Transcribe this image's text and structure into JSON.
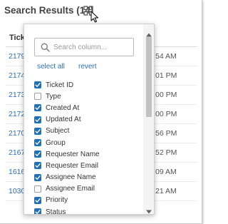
{
  "header": {
    "title": "Search Results (14)",
    "grid_icon": "grid-icon",
    "cursor_icon": "mouse-pointer-icon"
  },
  "table": {
    "column_header_visible": "Ticke",
    "rows": [
      {
        "id": "2179",
        "time": "54 AM"
      },
      {
        "id": "2174",
        "time": "01 PM"
      },
      {
        "id": "2173",
        "time": "00 PM"
      },
      {
        "id": "2172",
        "time": "00 PM"
      },
      {
        "id": "2170",
        "time": "56 PM"
      },
      {
        "id": "2167",
        "time": "52 PM"
      },
      {
        "id": "1616",
        "time": "09 AM"
      },
      {
        "id": "1030",
        "time": "21 AM"
      }
    ]
  },
  "column_picker": {
    "search_placeholder": "Search column...",
    "search_value": "",
    "select_all_label": "select all",
    "revert_label": "revert",
    "columns": [
      {
        "label": "Ticket ID",
        "checked": true
      },
      {
        "label": "Type",
        "checked": false
      },
      {
        "label": "Created At",
        "checked": true
      },
      {
        "label": "Updated At",
        "checked": true
      },
      {
        "label": "Subject",
        "checked": true
      },
      {
        "label": "Group",
        "checked": true
      },
      {
        "label": "Requester Name",
        "checked": true
      },
      {
        "label": "Requester Email",
        "checked": true
      },
      {
        "label": "Assignee Name",
        "checked": true
      },
      {
        "label": "Assignee Email",
        "checked": false
      },
      {
        "label": "Priority",
        "checked": true
      },
      {
        "label": "Status",
        "checked": true
      }
    ]
  },
  "colors": {
    "link": "#2f6fb2",
    "checkbox_checked": "#1f6fb5",
    "scrollbar_thumb": "#c2c2c2"
  }
}
